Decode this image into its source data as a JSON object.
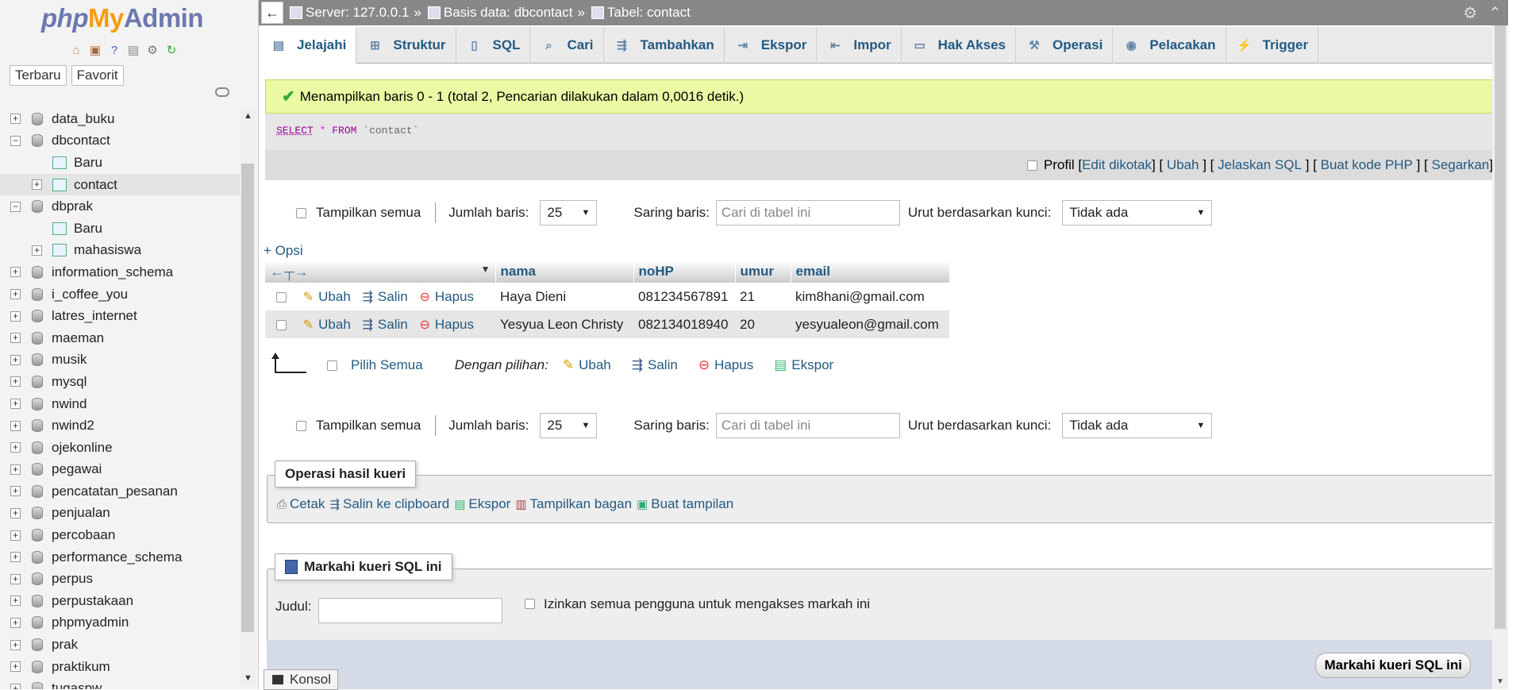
{
  "sidebar": {
    "logo": {
      "php": "php",
      "my": "My",
      "admin": "Admin"
    },
    "tabs": [
      "Terbaru",
      "Favorit"
    ],
    "tree": [
      {
        "label": "data_buku",
        "type": "db",
        "expanded": false
      },
      {
        "label": "dbcontact",
        "type": "db",
        "expanded": true
      },
      {
        "label": "Baru",
        "type": "new"
      },
      {
        "label": "contact",
        "type": "table",
        "selected": true
      },
      {
        "label": "dbprak",
        "type": "db",
        "expanded": true
      },
      {
        "label": "Baru",
        "type": "new"
      },
      {
        "label": "mahasiswa",
        "type": "table"
      },
      {
        "label": "information_schema",
        "type": "db"
      },
      {
        "label": "i_coffee_you",
        "type": "db"
      },
      {
        "label": "latres_internet",
        "type": "db"
      },
      {
        "label": "maeman",
        "type": "db"
      },
      {
        "label": "musik",
        "type": "db"
      },
      {
        "label": "mysql",
        "type": "db"
      },
      {
        "label": "nwind",
        "type": "db"
      },
      {
        "label": "nwind2",
        "type": "db"
      },
      {
        "label": "ojekonline",
        "type": "db"
      },
      {
        "label": "pegawai",
        "type": "db"
      },
      {
        "label": "pencatatan_pesanan",
        "type": "db"
      },
      {
        "label": "penjualan",
        "type": "db"
      },
      {
        "label": "percobaan",
        "type": "db"
      },
      {
        "label": "performance_schema",
        "type": "db"
      },
      {
        "label": "perpus",
        "type": "db"
      },
      {
        "label": "perpustakaan",
        "type": "db"
      },
      {
        "label": "phpmyadmin",
        "type": "db"
      },
      {
        "label": "prak",
        "type": "db"
      },
      {
        "label": "praktikum",
        "type": "db"
      },
      {
        "label": "tugaspw",
        "type": "db"
      }
    ]
  },
  "breadcrumb": {
    "server": "Server: 127.0.0.1",
    "database": "Basis data: dbcontact",
    "table": "Tabel: contact",
    "separator": "»"
  },
  "tabs": [
    "Jelajahi",
    "Struktur",
    "SQL",
    "Cari",
    "Tambahkan",
    "Ekspor",
    "Impor",
    "Hak Akses",
    "Operasi",
    "Pelacakan",
    "Trigger"
  ],
  "message": "Menampilkan baris 0 - 1 (total 2, Pencarian dilakukan dalam 0,0016 detik.)",
  "sql": {
    "select": "SELECT",
    "star": "*",
    "from": "FROM",
    "table": "`contact`"
  },
  "sql_links": {
    "profil": "Profil",
    "edit_inline": "Edit dikotak",
    "edit": "Ubah",
    "explain": "Jelaskan SQL",
    "php": "Buat kode PHP",
    "refresh": "Segarkan"
  },
  "nav": {
    "show_all": "Tampilkan semua",
    "rows_label": "Jumlah baris:",
    "rows_value": "25",
    "filter_label": "Saring baris:",
    "filter_placeholder": "Cari di tabel ini",
    "sort_label": "Urut berdasarkan kunci:",
    "sort_value": "Tidak ada"
  },
  "options_link": "+ Opsi",
  "table": {
    "columns": [
      "nama",
      "noHP",
      "umur",
      "email"
    ],
    "actions": {
      "edit": "Ubah",
      "copy": "Salin",
      "delete": "Hapus"
    },
    "rows": [
      {
        "nama": "Haya Dieni",
        "noHP": "081234567891",
        "umur": "21",
        "email": "kim8hani@gmail.com"
      },
      {
        "nama": "Yesyua Leon Christy",
        "noHP": "082134018940",
        "umur": "20",
        "email": "yesyualeon@gmail.com"
      }
    ]
  },
  "bulk": {
    "select_all": "Pilih Semua",
    "with_selected": "Dengan pilihan:",
    "edit": "Ubah",
    "copy": "Salin",
    "delete": "Hapus",
    "export": "Ekspor"
  },
  "query_ops": {
    "legend": "Operasi hasil kueri",
    "print": "Cetak",
    "copy_clipboard": "Salin ke clipboard",
    "export": "Ekspor",
    "chart": "Tampilkan bagan",
    "create_view": "Buat tampilan"
  },
  "bookmark": {
    "legend": "Markahi kueri SQL ini",
    "title_label": "Judul:",
    "allow_all": "Izinkan semua pengguna untuk mengakses markah ini",
    "button": "Markahi kueri SQL ini"
  },
  "console": "Konsol"
}
